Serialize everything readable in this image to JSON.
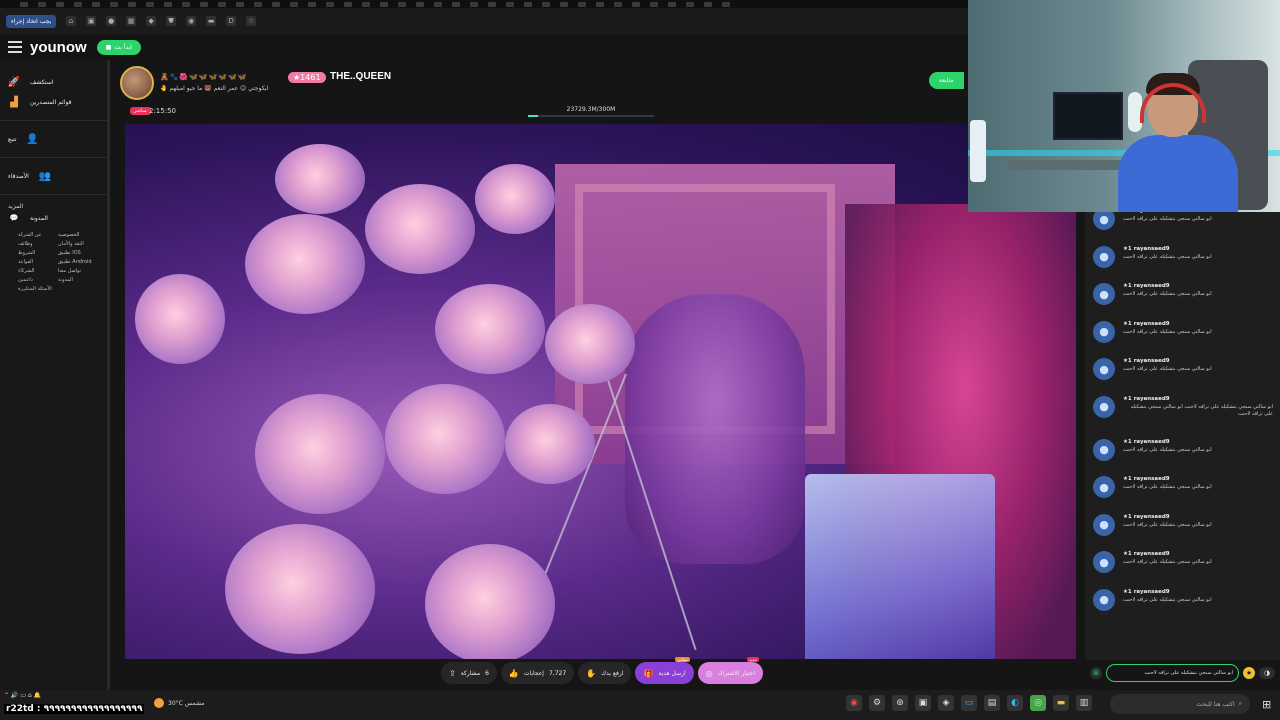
{
  "bookmarks": {
    "import_button": "يجب اتخاذ إجراء"
  },
  "header": {
    "logo": "younow",
    "go_live": "ابدأ بث"
  },
  "sidebar": {
    "items": [
      {
        "label": "استكشف",
        "icon": "rocket-icon"
      },
      {
        "label": "قوائم المتصدرين",
        "icon": "leaderboard-icon"
      },
      {
        "label": "تتبع",
        "icon": "add-user-icon"
      },
      {
        "label": "الأصدقاء",
        "icon": "friends-icon"
      }
    ],
    "section_title": "المزيد",
    "blog": "المدونة",
    "links": [
      "عن الشركة",
      "الخصوصية",
      "وظائف",
      "الثقة والأمان",
      "الشروط",
      "تطبيق IOS",
      "القواعد",
      "تطبيق Android",
      "الشركاء",
      "تواصل معنا",
      "داعمين",
      "المدونة",
      "الأسئلة المتكررة",
      ""
    ]
  },
  "stream": {
    "name": "THE..QUEEN",
    "level": "★1461",
    "badges": "🧸🐾🌺🦋🦋🦋🦋🦋🦋 ",
    "subtitle": "🤚 ايكوجتي 😊 عمر النعم 🐻 ما جيو امبلهم",
    "live_label": "مباشر",
    "timer": "2:15:50",
    "goal": "23729.3M/300M",
    "goal_progress": 0.08,
    "follow": "متابعة"
  },
  "actions": [
    {
      "label": "مشاركة",
      "count": "6",
      "icon": "share-icon"
    },
    {
      "label": "إعجابات",
      "count": "7,727",
      "icon": "like-icon"
    },
    {
      "label": "ارفع يدك",
      "icon": "raise-hand-icon"
    },
    {
      "label": "ارسل هدية",
      "icon": "gift-icon",
      "tag": "مجاني"
    },
    {
      "label": "اختيار الاشتراك",
      "icon": "subscribe-icon",
      "tag": "جديد"
    }
  ],
  "chat": {
    "messages": [
      {
        "user": "rayansaed9",
        "text": "ابو سالتي سنجي بتشكيله على تراقه لاحنت"
      },
      {
        "user": "rayansaed9",
        "text": "ابو سالتي سنجي بتشكيله على تراقه لاحنت"
      },
      {
        "user": "rayansaed9",
        "text": "ابو سالتي سنجي بتشكيله على تراقه لاحنت"
      },
      {
        "user": "rayansaed9",
        "text": "ابو سالتي سنجي بتشكيله على تراقه لاحنت"
      },
      {
        "user": "rayansaed9",
        "text": "ابو سالتي سنجي بتشكيله على تراقه لاحنت"
      },
      {
        "user": "rayansaed9",
        "text": "ابو سالتي سنجي بتشكيله على تراقه لاحنت ابو سالتي سنجي بتشكيله على تراقه لاحنت"
      },
      {
        "user": "rayansaed9",
        "text": "ابو سالتي سنجي بتشكيله على تراقه لاحنت"
      },
      {
        "user": "rayansaed9",
        "text": "ابو سالتي سنجي بتشكيله على تراقه لاحنت"
      },
      {
        "user": "rayansaed9",
        "text": "ابو سالتي سنجي بتشكيله على تراقه لاحنت"
      },
      {
        "user": "rayansaed9",
        "text": "ابو سالتي سنجي بتشكيله على تراقه لاحنت"
      },
      {
        "user": "rayansaed9",
        "text": "ابو سالتي سنجي بتشكيله على تراقه لاحنت"
      }
    ],
    "input_value": "ابو سالتي سنجي بتشكيله على تراقه لاحنت",
    "level_prefix": "★1"
  },
  "taskbar": {
    "search_placeholder": "اكتب هنا للبحث",
    "weather": "30°C مشمس",
    "ticker": "r22td : ٩٩٩٩٩٩٩٩٩٩٩٩٩٩٩٩٩٩"
  }
}
